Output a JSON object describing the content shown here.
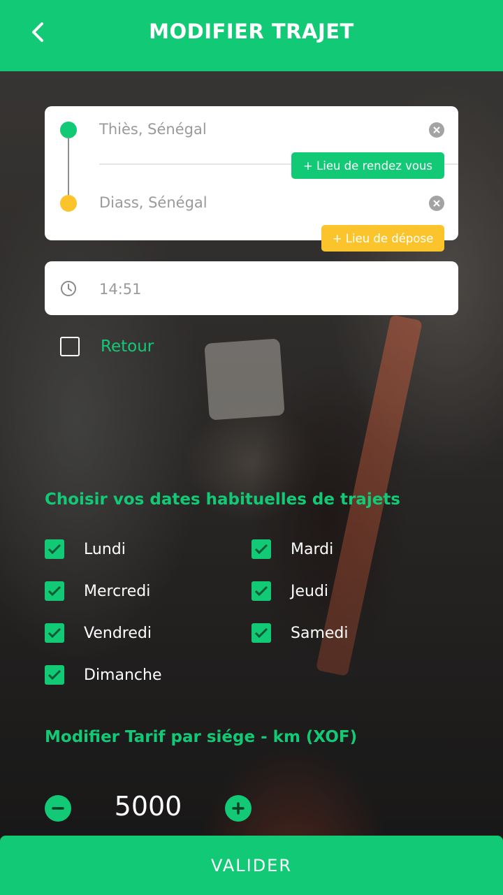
{
  "header": {
    "title": "MODIFIER TRAJET",
    "back_icon": "chevron-left-icon"
  },
  "route": {
    "start": "Thiès, Sénégal",
    "end": "Diass, Sénégal",
    "meeting_point_label": "+ Lieu de rendez vous",
    "dropoff_label": "+ Lieu de dépose"
  },
  "time": {
    "value": "14:51",
    "icon": "clock-icon"
  },
  "return_trip": {
    "label": "Retour",
    "checked": false
  },
  "days_section": {
    "title": "Choisir vos dates habituelles de trajets",
    "days": [
      {
        "label": "Lundi",
        "checked": true
      },
      {
        "label": "Mardi",
        "checked": true
      },
      {
        "label": "Mercredi",
        "checked": true
      },
      {
        "label": "Jeudi",
        "checked": true
      },
      {
        "label": "Vendredi",
        "checked": true
      },
      {
        "label": "Samedi",
        "checked": true
      },
      {
        "label": "Dimanche",
        "checked": true
      }
    ]
  },
  "price_section": {
    "title": "Modifier Tarif par siége - km (XOF)",
    "value": "5000"
  },
  "submit": {
    "label": "VALIDER"
  },
  "colors": {
    "accent": "#12ca76",
    "secondary": "#fcc42c"
  }
}
